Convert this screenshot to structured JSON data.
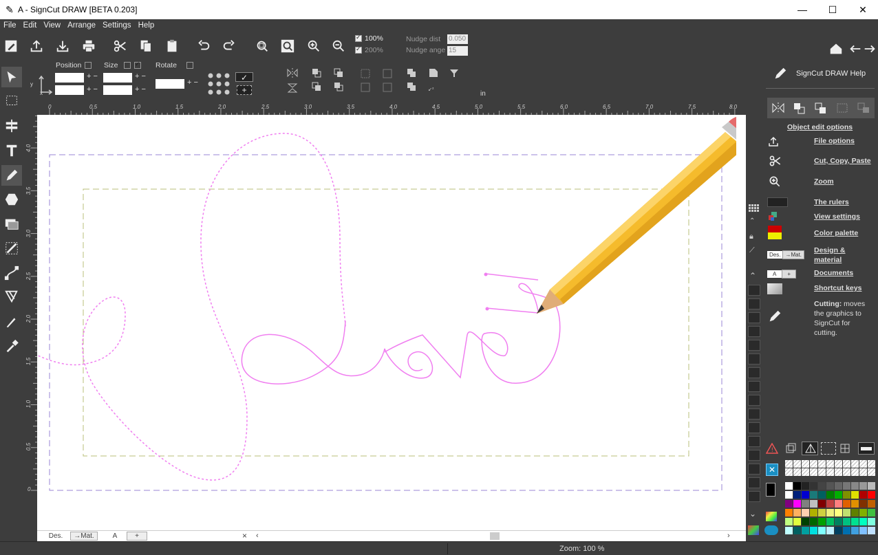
{
  "window": {
    "title": "A - SignCut DRAW  [BETA 0.203]",
    "min": "—",
    "max": "☐",
    "close": "✕"
  },
  "menu": [
    "File",
    "Edit",
    "View",
    "Arrange",
    "Settings",
    "Help"
  ],
  "toolbar": {
    "zoom100": "100%",
    "zoom200": "200%",
    "nudge_dist_label": "Nudge dist",
    "nudge_dist_value": "0.050",
    "nudge_angle_label": "Nudge ange",
    "nudge_angle_value": "15"
  },
  "props": {
    "position_label": "Position",
    "size_label": "Size",
    "rotate_label": "Rotate",
    "unit": "in",
    "axis_x": "x",
    "axis_y": "y"
  },
  "ruler": {
    "top": [
      "0",
      "0.5",
      "1.0",
      "1.5",
      "2.0",
      "2.5",
      "3.0",
      "3.5",
      "4.0",
      "4.5",
      "5.0",
      "5.5",
      "6.0",
      "6.5",
      "7.0",
      "7.5",
      "8.0"
    ],
    "left": [
      "4.0",
      "3.5",
      "3.0",
      "2.5",
      "2.0",
      "1.5",
      "1.0",
      "0.5",
      "0"
    ]
  },
  "help": {
    "title": "SignCut DRAW Help",
    "object_edit": "Object edit options",
    "links": [
      {
        "label": "File options"
      },
      {
        "label": "Cut, Copy, Paste"
      },
      {
        "label": "Zoom"
      },
      {
        "label": "The rulers"
      },
      {
        "label": "View settings"
      },
      {
        "label": "Color palette"
      },
      {
        "label": "Design & material"
      },
      {
        "label": "Documents"
      },
      {
        "label": "Shortcut keys"
      }
    ],
    "des_label": "Des.",
    "mat_label": "→Mat.",
    "doc_label": "A",
    "doc_plus": "+",
    "cutting_bold": "Cutting:",
    "cutting_text": " moves the graphics to SignCut for cutting."
  },
  "tabs": {
    "des": "Des.",
    "mat": "→Mat.",
    "doc": "A",
    "add": "+",
    "close": "×"
  },
  "status": {
    "zoom": "Zoom: 100 %"
  },
  "colors": {
    "stroke": "#f07ef0",
    "outer_dash": "#9a86d6",
    "inner_dash": "#b8bf7a",
    "pencil": "#f5bb2c"
  }
}
